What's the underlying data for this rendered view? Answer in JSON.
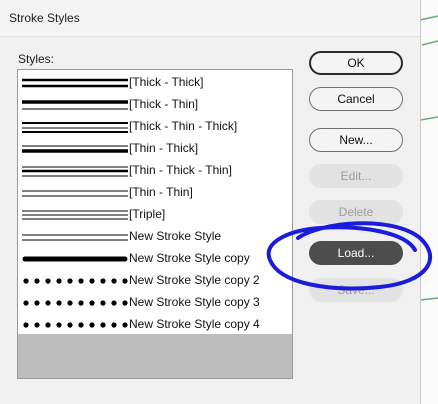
{
  "window": {
    "title": "Stroke Styles"
  },
  "styles_label": "Styles:",
  "styles": [
    {
      "name": "[Thick - Thick]",
      "pattern": "thick-thick"
    },
    {
      "name": "[Thick - Thin]",
      "pattern": "thick-thin"
    },
    {
      "name": "[Thick - Thin - Thick]",
      "pattern": "thick-thin-thick"
    },
    {
      "name": "[Thin - Thick]",
      "pattern": "thin-thick"
    },
    {
      "name": "[Thin - Thick - Thin]",
      "pattern": "thin-thick-thin"
    },
    {
      "name": "[Thin - Thin]",
      "pattern": "thin-thin"
    },
    {
      "name": "[Triple]",
      "pattern": "triple"
    },
    {
      "name": "New Stroke Style",
      "pattern": "thin-thin"
    },
    {
      "name": "New Stroke Style copy",
      "pattern": "heavy-rounded"
    },
    {
      "name": "New Stroke Style copy 2",
      "pattern": "dots"
    },
    {
      "name": "New Stroke Style copy 3",
      "pattern": "dots"
    },
    {
      "name": "New Stroke Style copy 4",
      "pattern": "dots"
    }
  ],
  "buttons": {
    "ok": "OK",
    "cancel": "Cancel",
    "new": "New...",
    "edit": "Edit...",
    "delete": "Delete",
    "load": "Load...",
    "save": "Save..."
  },
  "colors": {
    "annotation": "#1b1bdc",
    "active_button": "#4d4d4d"
  }
}
